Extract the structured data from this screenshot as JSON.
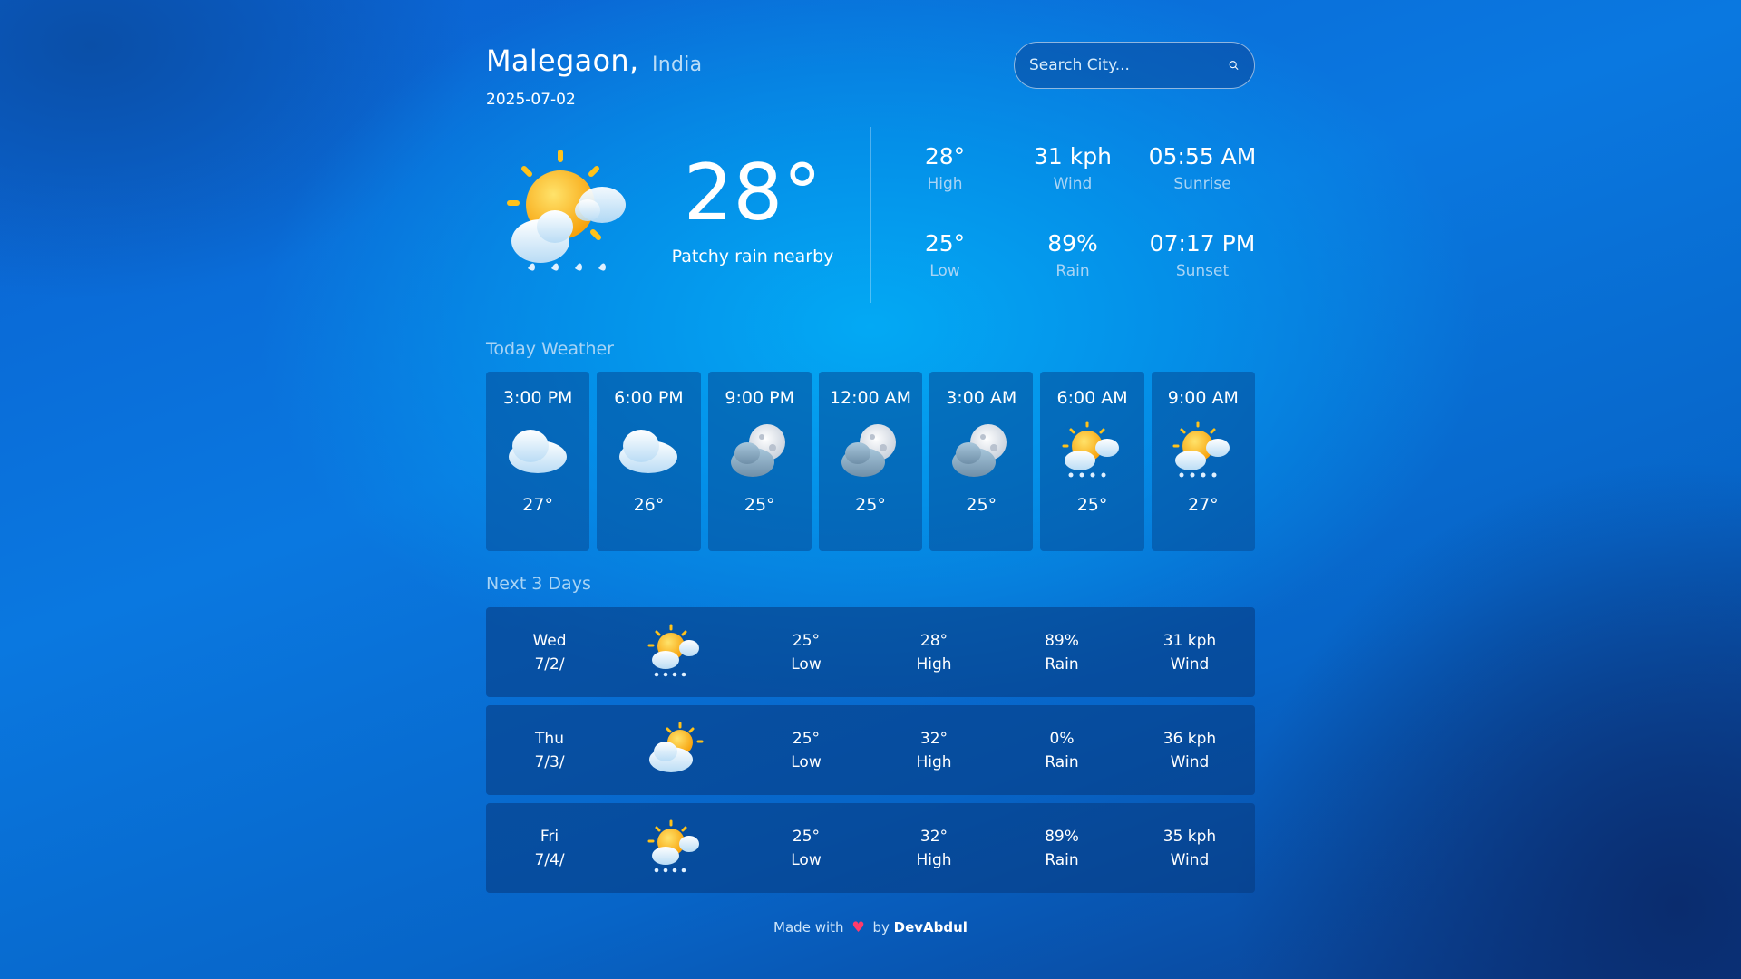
{
  "header": {
    "city": "Malegaon,",
    "country": "India",
    "date": "2025-07-02",
    "search_placeholder": "Search City..."
  },
  "current": {
    "temp": "28°",
    "condition": "Patchy rain nearby",
    "icon": "sun-cloud-rain-icon",
    "stats": [
      {
        "value": "28°",
        "label": "High"
      },
      {
        "value": "31 kph",
        "label": "Wind"
      },
      {
        "value": "05:55 AM",
        "label": "Sunrise"
      },
      {
        "value": "25°",
        "label": "Low"
      },
      {
        "value": "89%",
        "label": "Rain"
      },
      {
        "value": "07:17 PM",
        "label": "Sunset"
      }
    ]
  },
  "hourly": {
    "title": "Today Weather",
    "items": [
      {
        "time": "3:00 PM",
        "temp": "27°",
        "icon": "cloud-icon"
      },
      {
        "time": "6:00 PM",
        "temp": "26°",
        "icon": "cloud-icon"
      },
      {
        "time": "9:00 PM",
        "temp": "25°",
        "icon": "moon-cloud-icon"
      },
      {
        "time": "12:00 AM",
        "temp": "25°",
        "icon": "moon-cloud-icon"
      },
      {
        "time": "3:00 AM",
        "temp": "25°",
        "icon": "moon-cloud-icon"
      },
      {
        "time": "6:00 AM",
        "temp": "25°",
        "icon": "sun-cloud-rain-icon"
      },
      {
        "time": "9:00 AM",
        "temp": "27°",
        "icon": "sun-cloud-rain-icon"
      }
    ]
  },
  "daily": {
    "title": "Next 3 Days",
    "items": [
      {
        "day": "Wed",
        "date": "7/2/",
        "icon": "sun-cloud-rain-icon",
        "low": "25°",
        "low_label": "Low",
        "high": "28°",
        "high_label": "High",
        "rain": "89%",
        "rain_label": "Rain",
        "wind": "31 kph",
        "wind_label": "Wind"
      },
      {
        "day": "Thu",
        "date": "7/3/",
        "icon": "sun-cloud-icon",
        "low": "25°",
        "low_label": "Low",
        "high": "32°",
        "high_label": "High",
        "rain": "0%",
        "rain_label": "Rain",
        "wind": "36 kph",
        "wind_label": "Wind"
      },
      {
        "day": "Fri",
        "date": "7/4/",
        "icon": "sun-cloud-rain-icon",
        "low": "25°",
        "low_label": "Low",
        "high": "32°",
        "high_label": "High",
        "rain": "89%",
        "rain_label": "Rain",
        "wind": "35 kph",
        "wind_label": "Wind"
      }
    ]
  },
  "footer": {
    "made_with": "Made with",
    "heart": "♥",
    "by": "by",
    "author": "DevAbdul"
  },
  "colors": {
    "accent_label": "#a9d4f5",
    "heart": "#ff3b6b",
    "sun": "#ffc21a",
    "cloud": "#e6f3ff"
  }
}
